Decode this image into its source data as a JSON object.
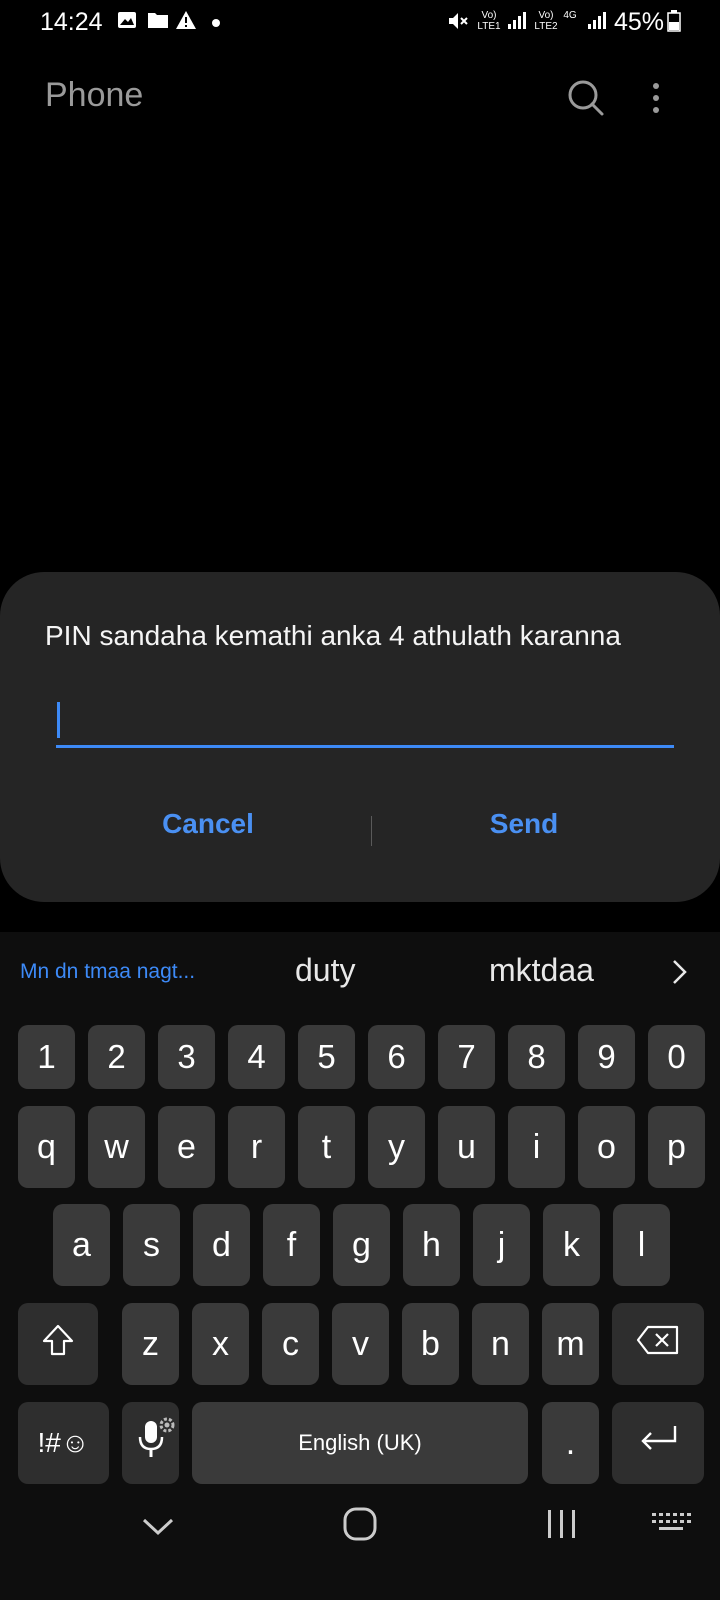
{
  "status_bar": {
    "time": "14:24",
    "battery": "45%",
    "network": [
      "Vo) LTE1",
      "Vo) LTE2",
      "4G"
    ]
  },
  "header": {
    "title": "Phone"
  },
  "dialog": {
    "message": "PIN sandaha kemathi anka 4  athulath karanna",
    "input_value": "",
    "cancel_label": "Cancel",
    "send_label": "Send"
  },
  "keyboard": {
    "suggestions": [
      "Mn dn tmaa nagt...",
      "duty",
      "mktdaa"
    ],
    "number_row": [
      "1",
      "2",
      "3",
      "4",
      "5",
      "6",
      "7",
      "8",
      "9",
      "0"
    ],
    "row1": [
      "q",
      "w",
      "e",
      "r",
      "t",
      "y",
      "u",
      "i",
      "o",
      "p"
    ],
    "row2": [
      "a",
      "s",
      "d",
      "f",
      "g",
      "h",
      "j",
      "k",
      "l"
    ],
    "row3": [
      "z",
      "x",
      "c",
      "v",
      "b",
      "n",
      "m"
    ],
    "symbols_label": "!#☺",
    "space_label": "English (UK)",
    "period_label": "."
  },
  "colors": {
    "accent": "#3d8af7",
    "dialog_bg": "#252525",
    "key_bg": "#3a3a3a"
  }
}
